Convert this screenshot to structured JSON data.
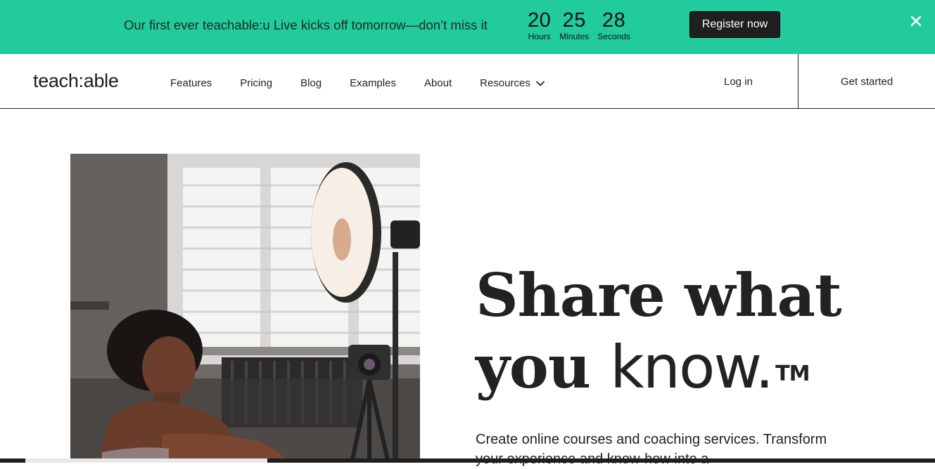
{
  "banner": {
    "message": "Our first ever teachable:u Live kicks off tomorrow—don’t miss it",
    "countdown": [
      {
        "value": "20",
        "label": "Hours"
      },
      {
        "value": "25",
        "label": "Minutes"
      },
      {
        "value": "28",
        "label": "Seconds"
      }
    ],
    "register_label": "Register now",
    "background_color": "#22cb9b"
  },
  "nav": {
    "logo": "teach:able",
    "links": [
      "Features",
      "Pricing",
      "Blog",
      "Examples",
      "About",
      "Resources"
    ],
    "login_label": "Log in",
    "get_started_label": "Get started"
  },
  "hero": {
    "headline_line1": "Share what",
    "headline_line2_a": "you ",
    "headline_line2_b": "know.",
    "trademark": "TM",
    "subtitle": "Create online courses and coaching services. Transform your experience and know-how into a"
  },
  "icons": {
    "close": "close-icon",
    "resources_dropdown": "chevron-down-icon"
  }
}
